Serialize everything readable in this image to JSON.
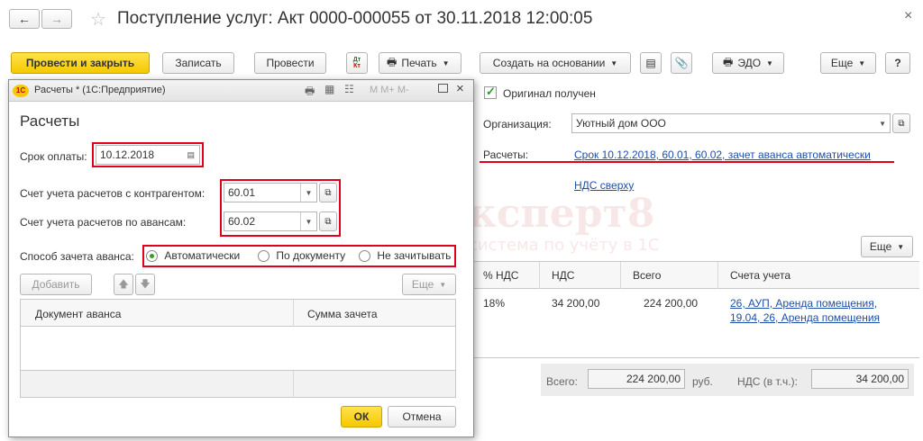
{
  "window": {
    "title": "Поступление услуг: Акт 0000-000055 от 30.11.2018 12:00:05",
    "close_glyph": "×"
  },
  "toolbar": {
    "post_and_close": "Провести и закрыть",
    "save": "Записать",
    "post": "Провести",
    "dt_kt": "Дт\nКт",
    "print": "Печать",
    "create_based": "Создать на основании",
    "edo": "ЭДО",
    "more": "Еще",
    "help": "?"
  },
  "form": {
    "original_received": "Оригинал получен",
    "organization_label": "Организация:",
    "organization_value": "Уютный дом ООО",
    "settlements_label": "Расчеты:",
    "settlements_link": "Срок 10.12.2018, 60.01, 60.02, зачет аванса автоматически",
    "vat_link": "НДС сверху",
    "table_more": "Еще",
    "table": {
      "headers": [
        "% НДС",
        "НДС",
        "Всего",
        "Счета учета"
      ],
      "rows": [
        {
          "vat_rate": "18%",
          "vat": "34 200,00",
          "total": "224 200,00",
          "accounts_line1": "26, АУП, Аренда помещения,",
          "accounts_line2": "19.04, 26, Аренда помещения"
        }
      ]
    },
    "footer": {
      "total_label": "Всего:",
      "total_value": "224 200,00",
      "currency": "руб.",
      "vat_label": "НДС (в т.ч.):",
      "vat_value": "34 200,00"
    }
  },
  "dialog": {
    "window_title": "Расчеты * (1С:Предприятие)",
    "title_icons": "M  M+  M-",
    "heading": "Расчеты",
    "payment_due_label": "Срок оплаты:",
    "payment_due_value": "10.12.2018",
    "counterparty_account_label": "Счет учета расчетов с контрагентом:",
    "counterparty_account_value": "60.01",
    "advance_account_label": "Счет учета расчетов по авансам:",
    "advance_account_value": "60.02",
    "advance_offset_label": "Способ зачета аванса:",
    "advance_options": [
      "Автоматически",
      "По документу",
      "Не зачитывать"
    ],
    "advance_selected": "Автоматически",
    "add_button": "Добавить",
    "more_button": "Еще",
    "grid_headers": [
      "Документ аванса",
      "Сумма зачета"
    ],
    "ok_button": "ОК",
    "cancel_button": "Отмена"
  },
  "watermark": {
    "brand": "БухЭксперт8",
    "tagline": "система по учёту в 1С"
  },
  "colors": {
    "accent_yellow": "#f5c800",
    "highlight_red": "#e3001b",
    "link_blue": "#1f4fa8"
  }
}
